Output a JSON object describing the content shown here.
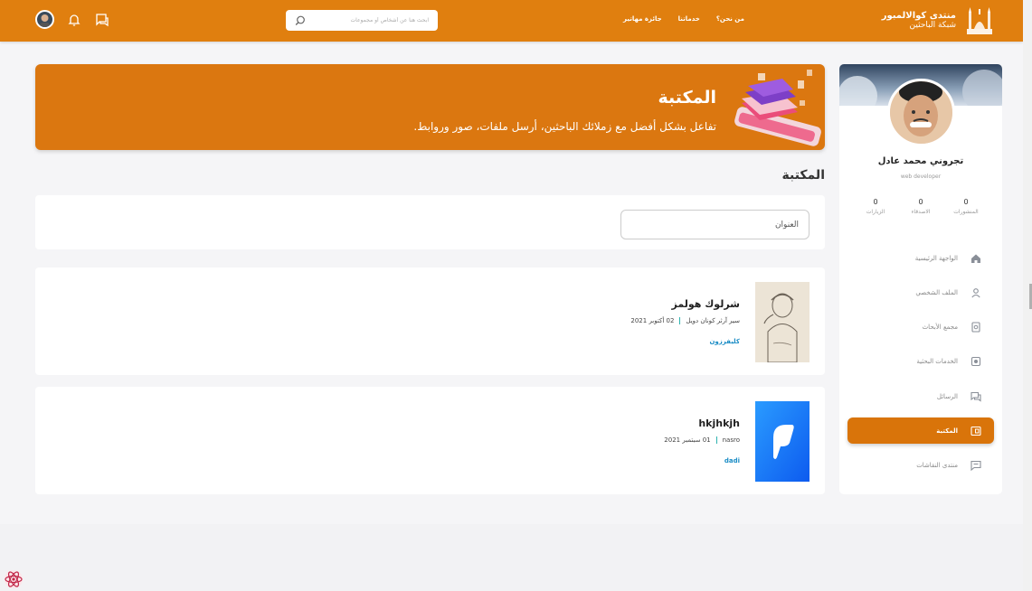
{
  "header": {
    "brand_title": "منتدى كوالالمبور",
    "brand_subtitle": "شبكة الباحثين",
    "nav": [
      "من نحن؟",
      "خدماتنا",
      "جائزة مهاتير"
    ],
    "search_placeholder": "ابحث هنا عن أشخاص أو مجموعات"
  },
  "profile": {
    "name": "تجروني محمد عادل",
    "role": "web developer",
    "stats": [
      {
        "value": "0",
        "label": "المنشورات"
      },
      {
        "value": "0",
        "label": "الاصدقاء"
      },
      {
        "value": "0",
        "label": "الزيارات"
      }
    ]
  },
  "sidebar": {
    "items": [
      {
        "label": "الواجهة الرئيسية",
        "icon": "home-icon"
      },
      {
        "label": "الملف الشخصي",
        "icon": "user-icon"
      },
      {
        "label": "مجمع الأبحاث",
        "icon": "research-icon"
      },
      {
        "label": "الخدمات البحثية",
        "icon": "services-icon"
      },
      {
        "label": "الرسائل",
        "icon": "messages-icon"
      },
      {
        "label": "المكتبة",
        "icon": "library-icon",
        "active": true
      },
      {
        "label": "منتدى النقاشات",
        "icon": "forum-icon"
      }
    ]
  },
  "banner": {
    "title": "المكتبة",
    "subtitle": "تفاعل بشكل أفضل مع زملائك الباحثين، أرسل ملفات، صور وروابط."
  },
  "page": {
    "section_title": "المكتبة",
    "filter_placeholder": "العنوان"
  },
  "books": [
    {
      "title": "شرلوك هولمز",
      "author": "سير آرثر كونان دويل",
      "date": "02 أكتوبر 2021",
      "tag": "كليفرزون"
    },
    {
      "title": "hkjhkjh",
      "author": "nasro",
      "date": "01 سبتمبر 2021",
      "tag": "dadi"
    }
  ],
  "colors": {
    "primary": "#e07f0f",
    "active": "#d9740a",
    "accent_teal": "#2eb3b0",
    "tag_blue": "#1a8cc5"
  }
}
